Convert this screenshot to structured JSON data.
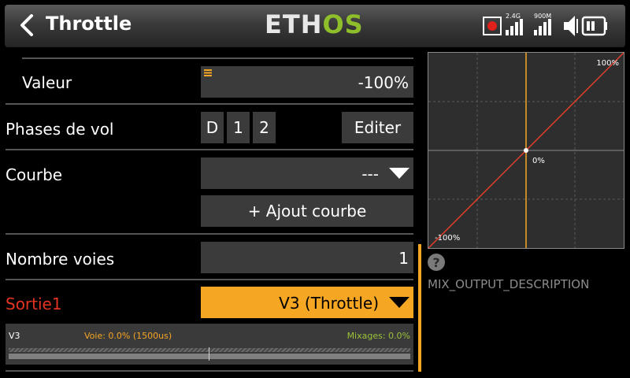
{
  "header": {
    "title": "Throttle",
    "logo_eth": "ETH",
    "logo_os": "OS",
    "rssi_24_label": "2.4G",
    "rssi_900_label": "900M"
  },
  "form": {
    "valeur": {
      "label": "Valeur",
      "value": "-100%"
    },
    "phases": {
      "label": "Phases de vol",
      "options": [
        "D",
        "1",
        "2"
      ],
      "edit_label": "Editer"
    },
    "courbe": {
      "label": "Courbe",
      "value": "---",
      "add_label": "+ Ajout courbe"
    },
    "nombre_voies": {
      "label": "Nombre voies",
      "value": "1"
    },
    "sortie": {
      "label": "Sortie1",
      "value": "V3 (Throttle)"
    }
  },
  "monitor": {
    "channel": "V3",
    "voie": "Voie: 0.0% (1500us)",
    "mixages": "Mixages: 0.0%"
  },
  "graph": {
    "top_label": "100%",
    "center_label": "0%",
    "bottom_label": "-100%"
  },
  "description": "MIX_OUTPUT_DESCRIPTION",
  "colors": {
    "accent": "#f5a623",
    "label_red": "#e53322",
    "curve": "#e0402a",
    "logo_green": "#8fbe2b",
    "mix_green": "#9cc23a"
  }
}
